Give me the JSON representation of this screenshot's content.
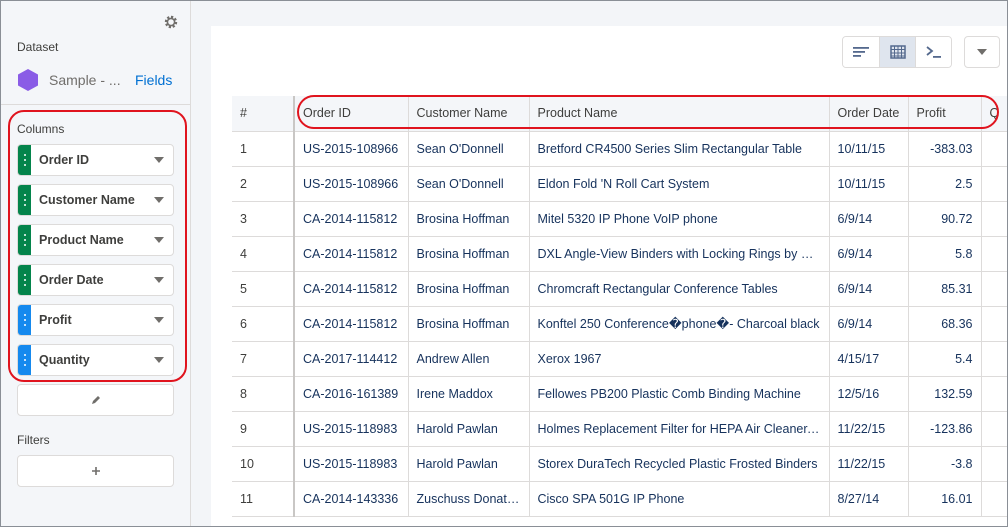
{
  "sidebar": {
    "settings_icon": "gear-icon",
    "dataset_label": "Dataset",
    "dataset_name": "Sample - ...",
    "dataset_icon": "hexagon-icon",
    "dataset_color": "#8a5ce6",
    "fields_link": "Fields",
    "columns_label": "Columns",
    "columns": [
      {
        "label": "Order ID",
        "kind": "dimension"
      },
      {
        "label": "Customer Name",
        "kind": "dimension"
      },
      {
        "label": "Product Name",
        "kind": "dimension"
      },
      {
        "label": "Order Date",
        "kind": "dimension"
      },
      {
        "label": "Profit",
        "kind": "measure"
      },
      {
        "label": "Quantity",
        "kind": "measure"
      }
    ],
    "edit_icon": "pencil-icon",
    "filters_label": "Filters",
    "add_filter_icon": "plus-icon"
  },
  "colors": {
    "dimension": "#04844b",
    "measure": "#1589ee",
    "annotation": "#e0141e",
    "link": "#0070d2"
  },
  "toolbar": {
    "buttons": [
      "sort-icon",
      "table-icon",
      "query-console-icon"
    ],
    "active": "table-icon",
    "menu_icon": "chevron-down-icon"
  },
  "table": {
    "headers": [
      "#",
      "Order ID",
      "Customer Name",
      "Product Name",
      "Order Date",
      "Profit",
      "Q"
    ],
    "rows": [
      [
        "1",
        "US-2015-108966",
        "Sean O'Donnell",
        "Bretford CR4500 Series Slim Rectangular Table",
        "10/11/15",
        "-383.03"
      ],
      [
        "2",
        "US-2015-108966",
        "Sean O'Donnell",
        "Eldon Fold 'N Roll Cart System",
        "10/11/15",
        "2.5"
      ],
      [
        "3",
        "CA-2014-115812",
        "Brosina Hoffman",
        "Mitel 5320 IP Phone VoIP phone",
        "6/9/14",
        "90.72"
      ],
      [
        "4",
        "CA-2014-115812",
        "Brosina Hoffman",
        "DXL Angle-View Binders with Locking Rings by Samsill",
        "6/9/14",
        "5.8"
      ],
      [
        "5",
        "CA-2014-115812",
        "Brosina Hoffman",
        "Chromcraft Rectangular Conference Tables",
        "6/9/14",
        "85.31"
      ],
      [
        "6",
        "CA-2014-115812",
        "Brosina Hoffman",
        "Konftel 250 Conference�phone�- Charcoal black",
        "6/9/14",
        "68.36"
      ],
      [
        "7",
        "CA-2017-114412",
        "Andrew Allen",
        "Xerox 1967",
        "4/15/17",
        "5.4"
      ],
      [
        "8",
        "CA-2016-161389",
        "Irene Maddox",
        "Fellowes PB200 Plastic Comb Binding Machine",
        "12/5/16",
        "132.59"
      ],
      [
        "9",
        "US-2015-118983",
        "Harold Pawlan",
        "Holmes Replacement Filter for HEPA Air Cleaner, Very Large Room",
        "11/22/15",
        "-123.86"
      ],
      [
        "10",
        "US-2015-118983",
        "Harold Pawlan",
        "Storex DuraTech Recycled Plastic Frosted Binders",
        "11/22/15",
        "-3.8"
      ],
      [
        "11",
        "CA-2014-143336",
        "Zuschuss Donatelli",
        "Cisco SPA 501G IP Phone",
        "8/27/14",
        "16.01"
      ]
    ]
  }
}
